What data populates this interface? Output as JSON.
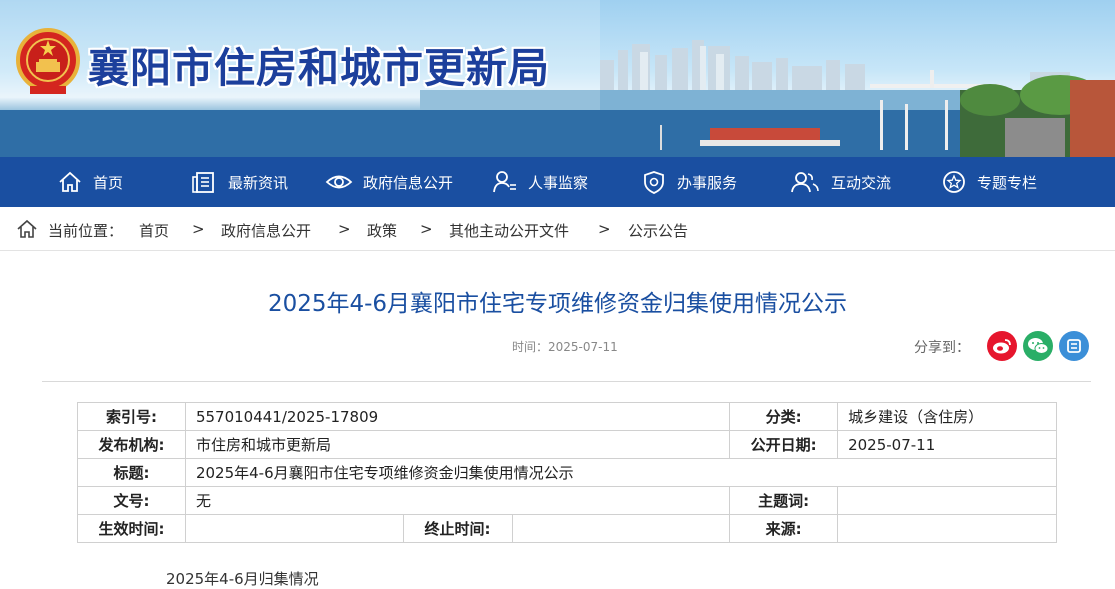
{
  "header": {
    "site_title": "襄阳市住房和城市更新局",
    "emblem_icon": "national-emblem-icon"
  },
  "nav": {
    "items": [
      {
        "label": "首页",
        "icon": "home-icon"
      },
      {
        "label": "最新资讯",
        "icon": "news-icon"
      },
      {
        "label": "政府信息公开",
        "icon": "eye-icon"
      },
      {
        "label": "人事监察",
        "icon": "person-icon"
      },
      {
        "label": "办事服务",
        "icon": "shield-icon"
      },
      {
        "label": "互动交流",
        "icon": "users-icon"
      },
      {
        "label": "专题专栏",
        "icon": "star-icon"
      }
    ]
  },
  "breadcrumb": {
    "prefix": "当前位置：",
    "items": [
      "首页",
      "政府信息公开",
      "政策",
      "其他主动公开文件",
      "公示公告"
    ],
    "separator": ">"
  },
  "article": {
    "title": "2025年4-6月襄阳市住宅专项维修资金归集使用情况公示",
    "time_label": "时间：2025-07-11",
    "share_label": "分享到：",
    "share_buttons": [
      {
        "icon": "weibo-icon",
        "color": "#e6162d"
      },
      {
        "icon": "wechat-icon",
        "color": "#2aae67"
      },
      {
        "icon": "qzone-icon",
        "color": "#3b8fd8"
      }
    ]
  },
  "meta_table": {
    "index_label": "索引号:",
    "index_value": "557010441/2025-17809",
    "category_label": "分类:",
    "category_value": "城乡建设（含住房）",
    "issuer_label": "发布机构:",
    "issuer_value": "市住房和城市更新局",
    "date_label": "公开日期:",
    "date_value": "2025-07-11",
    "title_label": "标题:",
    "title_value": "2025年4-6月襄阳市住宅专项维修资金归集使用情况公示",
    "docno_label": "文号:",
    "docno_value": "无",
    "keyword_label": "主题词:",
    "keyword_value": "",
    "effective_label": "生效时间:",
    "effective_value": "",
    "expire_label": "终止时间:",
    "expire_value": "",
    "source_label": "来源:",
    "source_value": ""
  },
  "body": {
    "first_line": "2025年4-6月归集情况"
  },
  "colors": {
    "nav_bg": "#1a4fa1",
    "title_blue": "#1a4fa1",
    "site_title": "#1c3f9c"
  }
}
